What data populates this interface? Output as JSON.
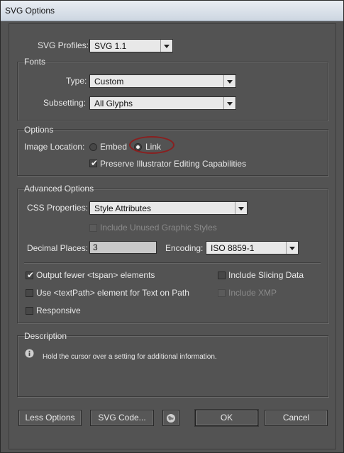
{
  "window": {
    "title": "SVG Options"
  },
  "svg_profiles": {
    "label": "SVG Profiles:",
    "value": "SVG 1.1"
  },
  "fonts": {
    "title": "Fonts",
    "type_label": "Type:",
    "type_value": "Custom",
    "subsetting_label": "Subsetting:",
    "subsetting_value": "All Glyphs"
  },
  "options": {
    "title": "Options",
    "image_location_label": "Image Location:",
    "embed_label": "Embed",
    "embed_selected": false,
    "link_label": "Link",
    "link_selected": true,
    "preserve_label": "Preserve Illustrator Editing Capabilities",
    "preserve_checked": true
  },
  "advanced": {
    "title": "Advanced Options",
    "css_label": "CSS Properties:",
    "css_value": "Style Attributes",
    "include_unused_label": "Include Unused Graphic Styles",
    "decimal_label": "Decimal Places:",
    "decimal_value": "3",
    "encoding_label": "Encoding:",
    "encoding_value": "ISO 8859-1",
    "output_fewer_label": "Output fewer <tspan> elements",
    "output_fewer_checked": true,
    "textpath_label": "Use <textPath> element for Text on Path",
    "responsive_label": "Responsive",
    "slicing_label": "Include Slicing Data",
    "xmp_label": "Include XMP"
  },
  "description": {
    "title": "Description",
    "text": "Hold the cursor over a setting for additional information."
  },
  "buttons": {
    "less_options": "Less Options",
    "svg_code": "SVG Code...",
    "ok": "OK",
    "cancel": "Cancel"
  },
  "icons": {
    "info": "info-icon",
    "web": "globe-icon"
  },
  "colors": {
    "annotation_circle": "#8a1f1f",
    "panel_bg": "#535353"
  }
}
